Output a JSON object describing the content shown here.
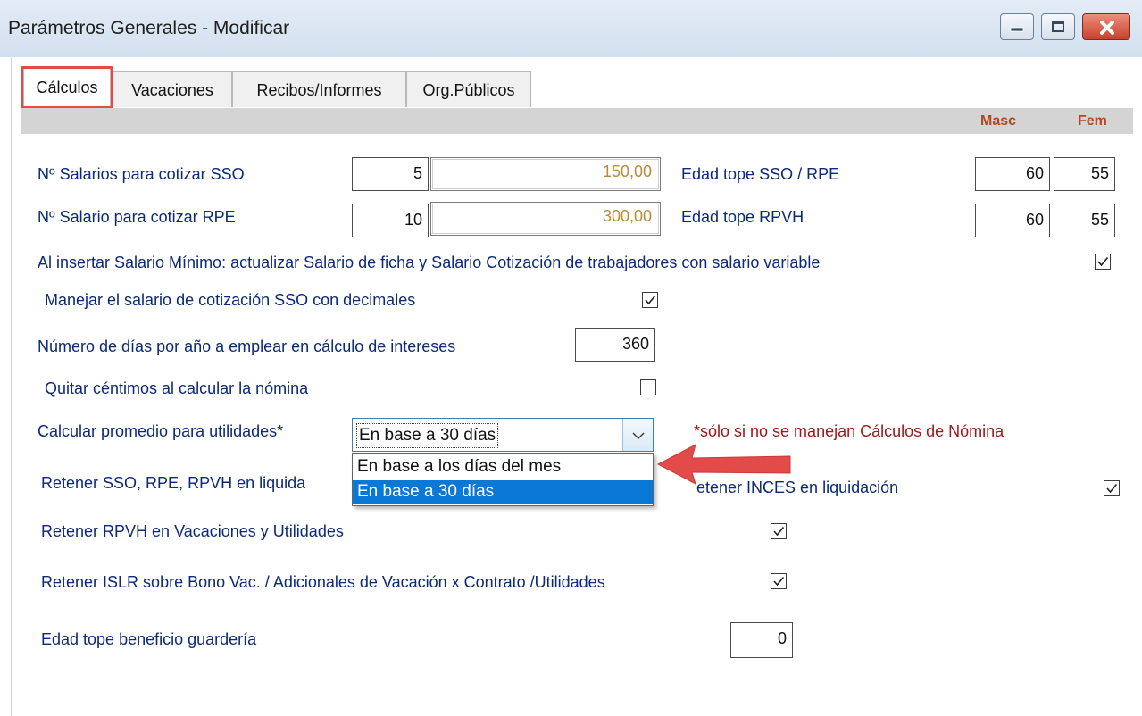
{
  "window": {
    "title": "Parámetros Generales - Modificar",
    "buttons": [
      "minimize",
      "maximize",
      "close"
    ]
  },
  "tabs": [
    {
      "label": "Cálculos",
      "active": true
    },
    {
      "label": "Vacaciones",
      "active": false
    },
    {
      "label": "Recibos/Informes",
      "active": false
    },
    {
      "label": "Org.Públicos",
      "active": false
    }
  ],
  "columns": {
    "masc": "Masc",
    "fem": "Fem"
  },
  "salarios_sso": {
    "label": "Nº Salarios para cotizar SSO",
    "count": "5",
    "amount": "150,00"
  },
  "salario_rpe": {
    "label": "Nº Salario para cotizar RPE",
    "count": "10",
    "amount": "300,00"
  },
  "edad_sso_rpe": {
    "label": "Edad tope SSO / RPE",
    "masc": "60",
    "fem": "55"
  },
  "edad_rpvh": {
    "label": "Edad tope RPVH",
    "masc": "60",
    "fem": "55"
  },
  "salario_minimo": {
    "label": "Al insertar Salario Mínimo: actualizar Salario de ficha y Salario Cotización de trabajadores con  salario variable",
    "checked": true
  },
  "salario_decimales": {
    "label": "Manejar el salario de cotización SSO con decimales",
    "checked": true
  },
  "dias_intereses": {
    "label": "Número de días por año a emplear en cálculo de intereses",
    "value": "360"
  },
  "quitar_centimos": {
    "label": "Quitar céntimos al calcular la nómina",
    "checked": false
  },
  "promedio_utilidades": {
    "label": "Calcular promedio para utilidades*",
    "value": "En base a 30 días",
    "options": [
      "En base a los días del mes",
      "En base a 30 días"
    ],
    "selected_index": 1,
    "note": "*sólo si no se manejan Cálculos de Nómina"
  },
  "retener_sso_liquidacion": {
    "label": "Retener SSO, RPE, RPVH en liquida"
  },
  "retener_inces": {
    "label": "Retener INCES en liquidación",
    "label_visible_part": "etener INCES en liquidación",
    "checked": true
  },
  "retener_rpvh": {
    "label": "Retener RPVH en Vacaciones y Utilidades",
    "checked": true
  },
  "retener_islr": {
    "label": "Retener ISLR sobre Bono Vac. / Adicionales de Vacación x Contrato /Utilidades",
    "checked": true
  },
  "edad_guarderia": {
    "label": "Edad tope beneficio guardería",
    "value": "0"
  },
  "colors": {
    "label": "#0c2a78",
    "note": "#a01818",
    "header": "#b3471f",
    "selection": "#0a78d7",
    "highlight": "#e24b49",
    "arrow": "#e24b49"
  }
}
